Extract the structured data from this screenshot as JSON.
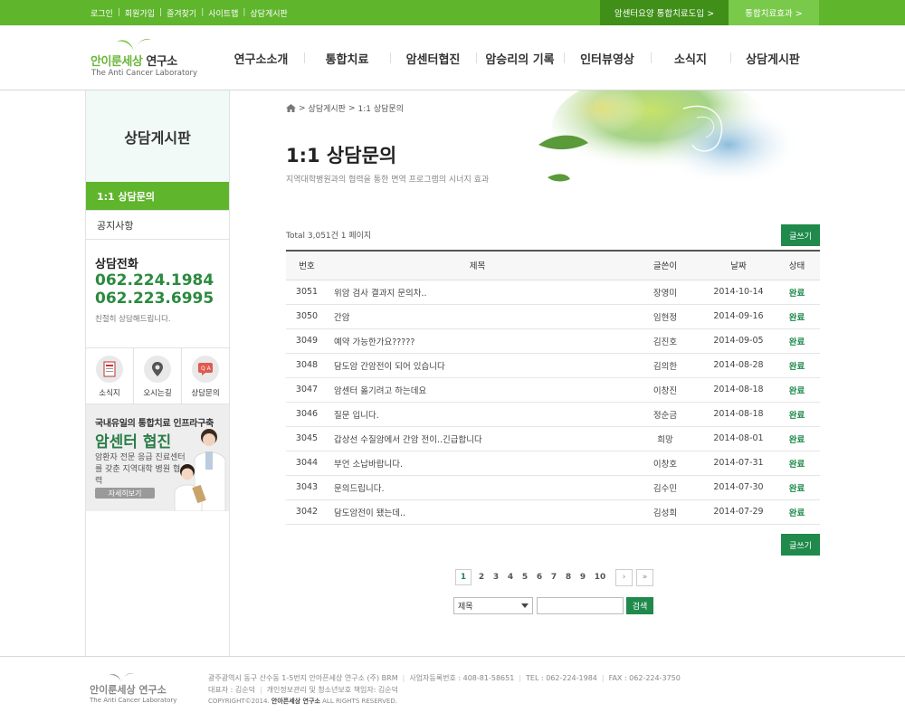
{
  "topbar": {
    "links": [
      "로그인",
      "회원가입",
      "즐겨찾기",
      "사이트맵",
      "상담게시판"
    ],
    "btn_intro": "암센터요양 통합치료도입 >",
    "btn_effect": "통합치료효과 >",
    "color_main": "#5fb52c",
    "color_dark": "#3f8f18"
  },
  "logo": {
    "brand_a": "안이룬세상",
    "brand_b": "연구소",
    "sub": "The Anti Cancer Laboratory"
  },
  "gnb": [
    "연구소소개",
    "통합치료",
    "암센터협진",
    "암승리의 기록",
    "인터뷰영상",
    "소식지",
    "상담게시판"
  ],
  "lnb": {
    "title": "상담게시판",
    "menu": [
      "1:1 상담문의",
      "공지사항"
    ],
    "tel_heading": "상담전화",
    "tel1": "062.224.1984",
    "tel2": "062.223.6995",
    "tel_note": "친절히 상담해드립니다.",
    "quick": [
      "소식지",
      "오시는길",
      "상담문의"
    ],
    "banner": {
      "line1": "국내유일의 통합치료 인프라구축",
      "line2": "암센터 협진",
      "line3": "암환자 전문 응급 진료센터를 갖춘 지역대학 병원 협력",
      "more": "자세히보기"
    }
  },
  "breadcrumb": {
    "section": "상담게시판",
    "page": "1:1 상담문의",
    "sep": ">"
  },
  "page": {
    "title": "1:1 상담문의",
    "desc": "지역대학병원과의 협력을 통한 면역 프로그램의 시너지 효과",
    "total": "Total 3,051건 1 페이지",
    "write": "글쓰기"
  },
  "table": {
    "headers": [
      "번호",
      "제목",
      "글쓴이",
      "날짜",
      "상태"
    ],
    "rows": [
      {
        "no": "3051",
        "title": "위암 검사 결과지 문의차..",
        "writer": "장영미",
        "date": "2014-10-14",
        "status": "완료"
      },
      {
        "no": "3050",
        "title": "간암",
        "writer": "임현정",
        "date": "2014-09-16",
        "status": "완료"
      },
      {
        "no": "3049",
        "title": "예약 가능한가요?????",
        "writer": "김진호",
        "date": "2014-09-05",
        "status": "완료"
      },
      {
        "no": "3048",
        "title": "담도암 간암전이 되어 있습니다",
        "writer": "김의한",
        "date": "2014-08-28",
        "status": "완료"
      },
      {
        "no": "3047",
        "title": "암센터 옮기려고 하는데요",
        "writer": "이창진",
        "date": "2014-08-18",
        "status": "완료"
      },
      {
        "no": "3046",
        "title": "질문 입니다.",
        "writer": "정순금",
        "date": "2014-08-18",
        "status": "완료"
      },
      {
        "no": "3045",
        "title": "갑상선 수질암에서 간암 전이..긴급합니다",
        "writer": "희망",
        "date": "2014-08-01",
        "status": "완료"
      },
      {
        "no": "3044",
        "title": "부언 소납바랍니다.",
        "writer": "이창호",
        "date": "2014-07-31",
        "status": "완료"
      },
      {
        "no": "3043",
        "title": "문의드립니다.",
        "writer": "김수민",
        "date": "2014-07-30",
        "status": "완료"
      },
      {
        "no": "3042",
        "title": "담도암전이 됐는데..",
        "writer": "김성희",
        "date": "2014-07-29",
        "status": "완료"
      }
    ]
  },
  "paging": {
    "pages": [
      "1",
      "2",
      "3",
      "4",
      "5",
      "6",
      "7",
      "8",
      "9",
      "10"
    ],
    "current": "1",
    "next": "›",
    "last": "»"
  },
  "search": {
    "field": "제목",
    "button": "검색",
    "value": ""
  },
  "footer": {
    "brand": "안이룬세상 연구소",
    "sub": "The Anti Cancer Laboratory",
    "address": "광주광역시 동구 산수동 1-5번지 안아픈세상 연구소 (주) BRM",
    "bizno": "사업자등록번호 : 408-81-58651",
    "tel": "TEL : 062-224-1984",
    "fax": "FAX : 062-224-3750",
    "ceo": "대표자 : 김순덕",
    "privacy": "개인정보관리 및 청소년보호 책임자: 김순덕",
    "copy_prefix": "COPYRIGHT©2014.",
    "copy_name": "안아픈세상 연구소",
    "copy_suffix": "ALL RIGHTS RESERVED."
  }
}
